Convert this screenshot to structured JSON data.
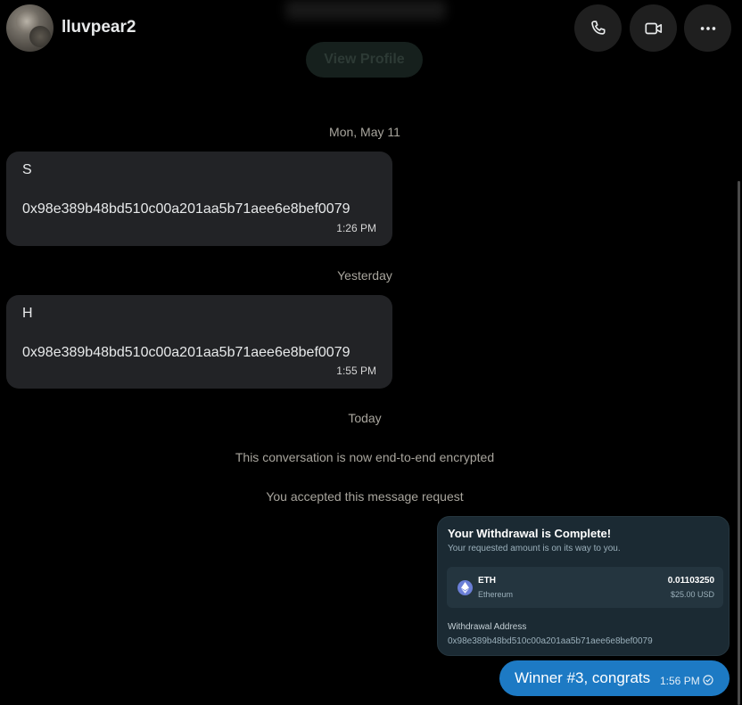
{
  "header": {
    "username": "lluvpear2",
    "view_profile_label": "View Profile",
    "icons": [
      "phone-icon",
      "video-icon",
      "more-icon"
    ]
  },
  "separators": {
    "date1": "Mon, May 11",
    "date2": "Yesterday",
    "date3": "Today"
  },
  "messages": [
    {
      "first_line": "S",
      "address": "0x98e389b48bd510c00a201aa5b71aee6e8bef0079",
      "time": "1:26 PM"
    },
    {
      "first_line": "H",
      "address": "0x98e389b48bd510c00a201aa5b71aee6e8bef0079",
      "time": "1:55 PM"
    }
  ],
  "system": {
    "encrypted": "This conversation is now end-to-end encrypted",
    "accepted": "You accepted this message request"
  },
  "card": {
    "title": "Your Withdrawal is Complete!",
    "subtitle": "Your requested amount is on its way to you.",
    "asset_symbol": "ETH",
    "asset_name": "Ethereum",
    "amount": "0.01103250",
    "usd": "$25.00 USD",
    "address_label": "Withdrawal Address",
    "address": "0x98e389b48bd510c00a201aa5b71aee6e8bef0079"
  },
  "sent_message": {
    "text": "Winner #3, congrats",
    "time": "1:56 PM"
  },
  "colors": {
    "background": "#000000",
    "bubble": "#222326",
    "sent_bubble": "#1d7ac4",
    "card": "#1b2a33"
  }
}
